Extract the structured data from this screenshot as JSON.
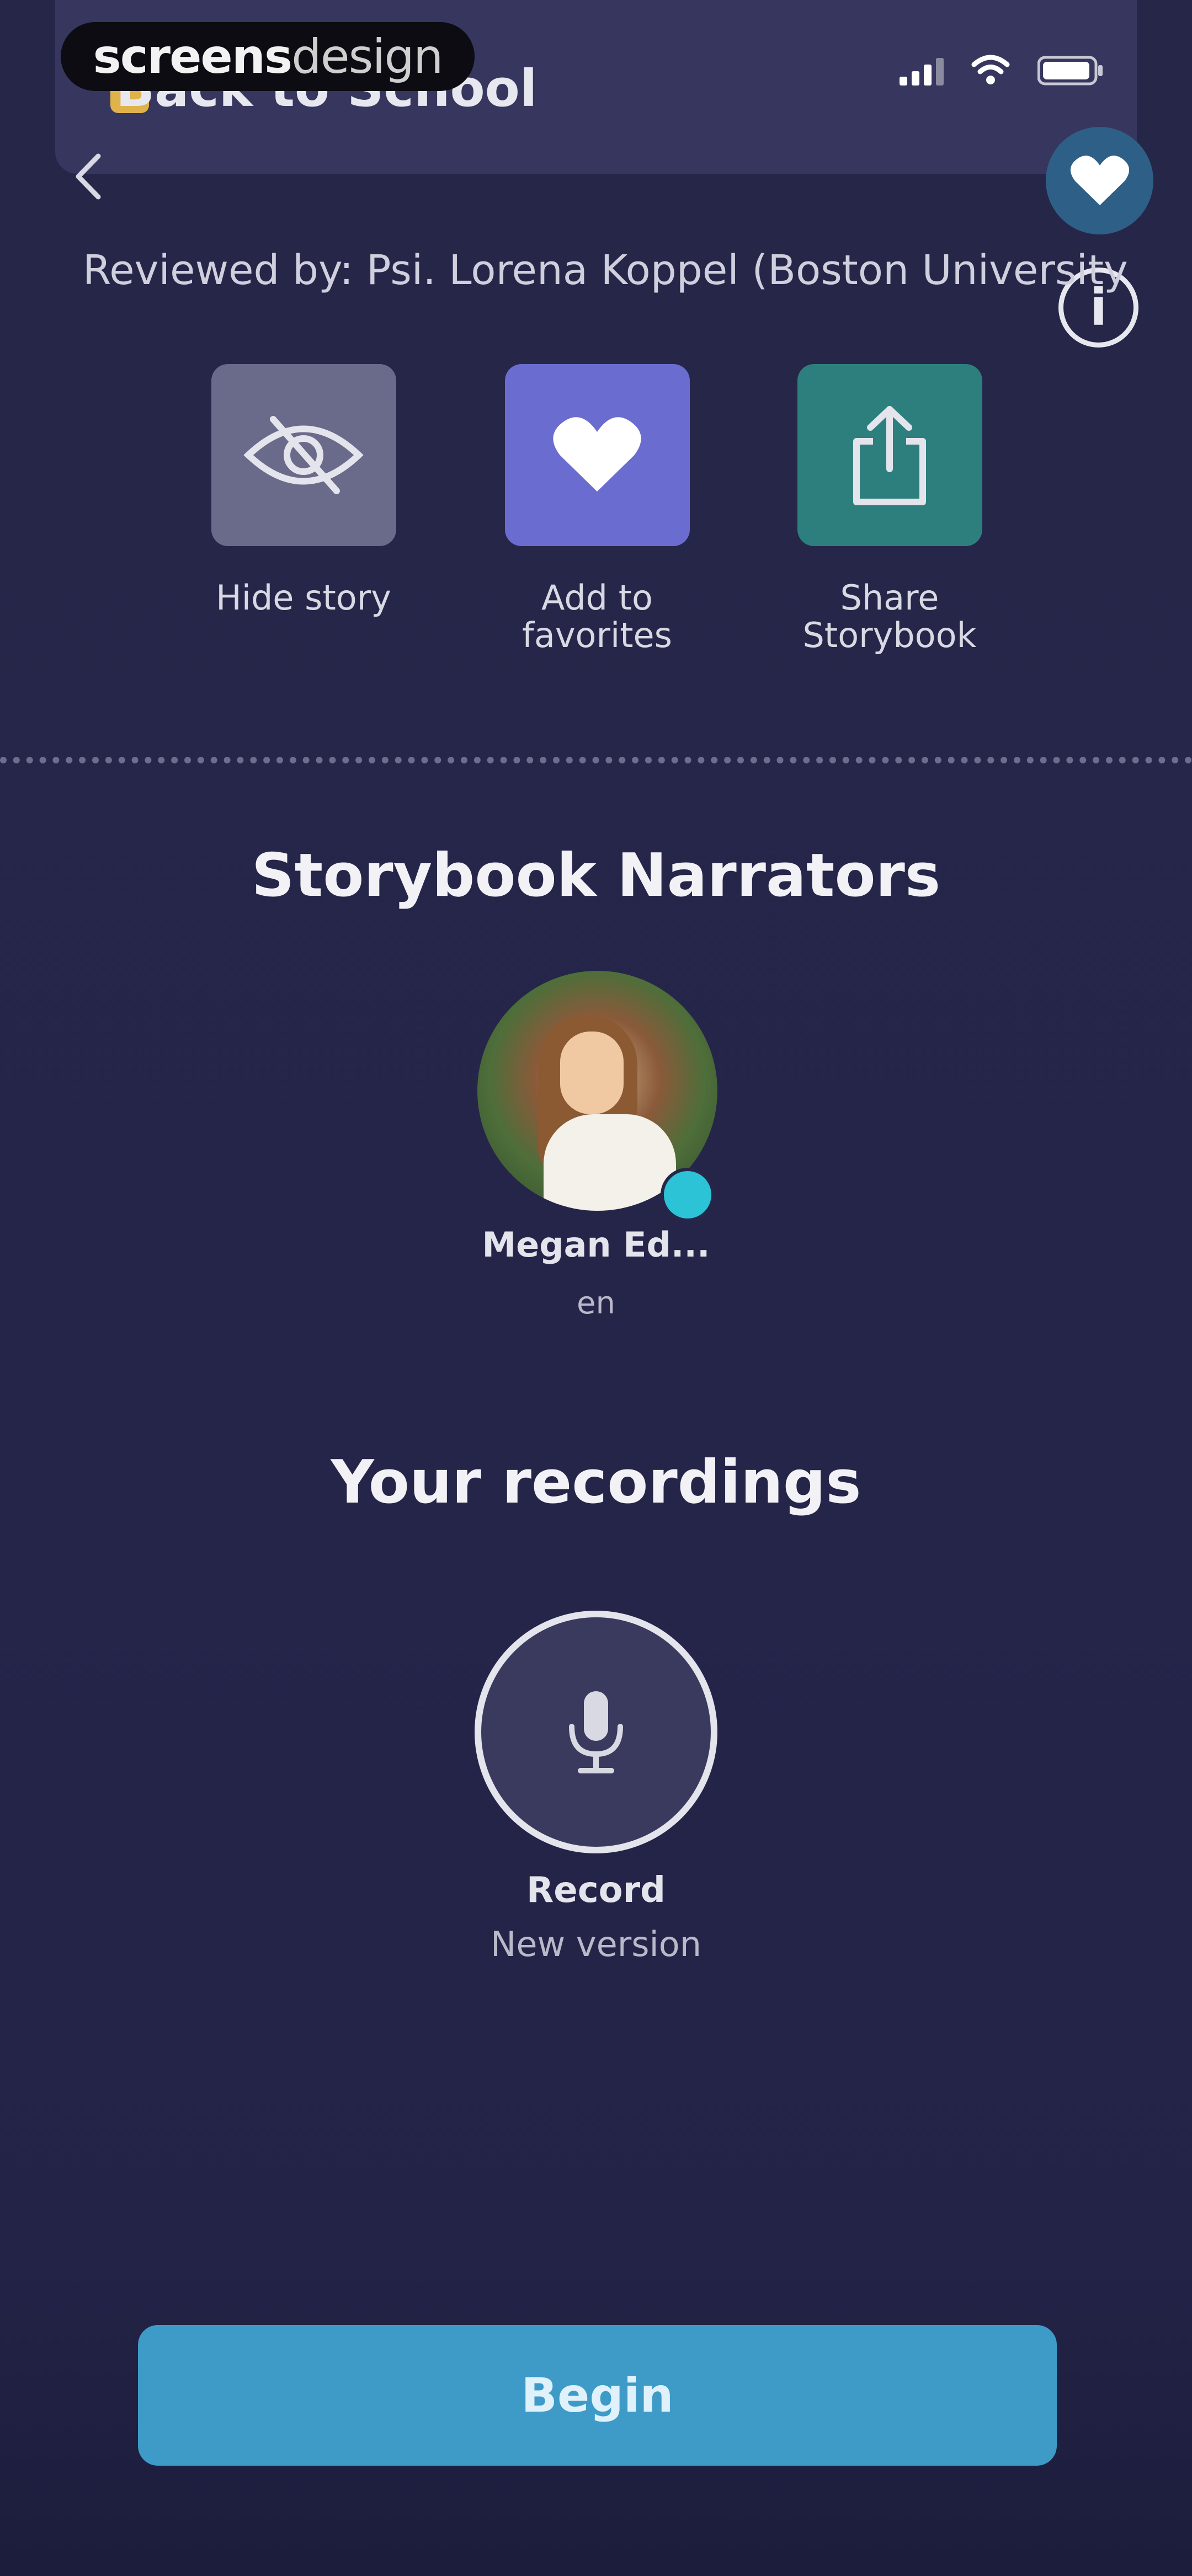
{
  "watermark": {
    "bold": "screens",
    "light": "design"
  },
  "header": {
    "story_title": "Back to School"
  },
  "reviewed_by": "Reviewed by: Psi. Lorena Koppel (Boston University)",
  "actions": [
    {
      "label": "Hide story",
      "icon": "eye-slash-icon"
    },
    {
      "label": "Add to\nfavorites",
      "icon": "heart-icon"
    },
    {
      "label": "Share\nStorybook",
      "icon": "share-icon"
    }
  ],
  "narrators": {
    "title": "Storybook Narrators",
    "items": [
      {
        "name": "Megan Ed...",
        "lang": "en"
      }
    ]
  },
  "recordings": {
    "title": "Your recordings",
    "record_label": "Record",
    "record_sub": "New version"
  },
  "begin_button": "Begin",
  "colors": {
    "background": "#262649",
    "hide_tile": "#6a6a8a",
    "favorite_tile": "#6b6cd0",
    "share_tile": "#2d7f7e",
    "begin_button": "#3e9bc7",
    "verified_badge": "#2cc3d6"
  }
}
